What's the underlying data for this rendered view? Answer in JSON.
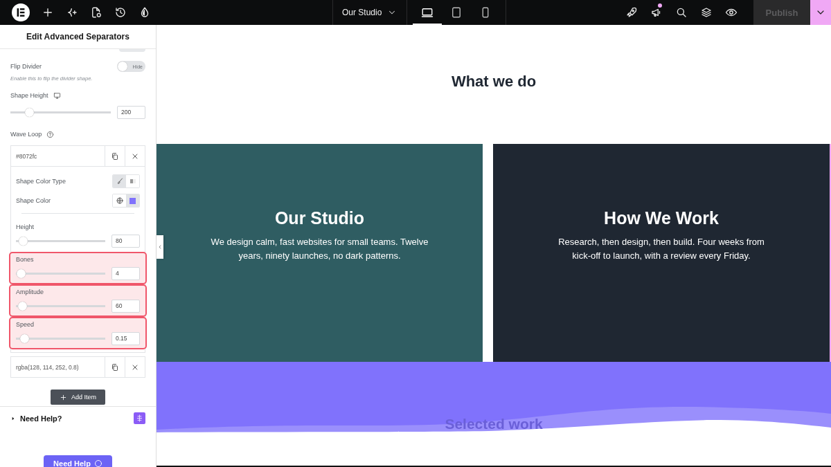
{
  "top_bar": {
    "page_selector": "Our Studio",
    "devices": [
      {
        "kind": "desktop",
        "selected": true
      },
      {
        "kind": "tablet",
        "selected": false
      },
      {
        "kind": "mobile",
        "selected": false
      }
    ],
    "notification": true,
    "publish": {
      "label": "Publish",
      "disabled": true
    }
  },
  "panel": {
    "title": "Edit Advanced Separators",
    "cut_toggle": {
      "on": false
    },
    "flip_divider": {
      "label": "Flip Divider",
      "toggle_label": "Hide",
      "on": false
    },
    "hint": "Enable this to flip the divider shape.",
    "shape_height": {
      "label": "Shape Height",
      "level": 0.19,
      "value": "200"
    },
    "wave_loop": {
      "label": "Wave Loop",
      "items": [
        {
          "value": "#8072fc",
          "expanded": true,
          "color_type_label": "Shape Color Type",
          "color_types": [
            {
              "kind": "solid",
              "selected": true
            },
            {
              "kind": "gradient",
              "selected": false
            }
          ],
          "color_label": "Shape Color",
          "color_sources": [
            {
              "kind": "global",
              "selected": false
            },
            {
              "kind": "custom",
              "selected": true,
              "color": "#8072fc"
            }
          ],
          "sliders": [
            {
              "label": "Height",
              "level": 0.08,
              "value": "80",
              "highlighted": false
            },
            {
              "label": "Bones",
              "level": 0.06,
              "value": "4",
              "highlighted": true
            },
            {
              "label": "Amplitude",
              "level": 0.07,
              "value": "60",
              "highlighted": true
            },
            {
              "label": "Speed",
              "level": 0.1,
              "value": "0.15",
              "highlighted": true
            }
          ]
        },
        {
          "value": "rgba(128, 114, 252, 0.8)",
          "expanded": false
        }
      ]
    },
    "add_item": "Add Item",
    "help": "Need Help?",
    "help_button": "Need Help"
  },
  "canvas": {
    "heading": "What we do",
    "cards": [
      {
        "title": "Our Studio",
        "text": "We design calm, fast websites for small teams. Twelve years, ninety launches, no dark patterns.",
        "color": "#2f5d62"
      },
      {
        "title": "How We Work",
        "text": "Research, then design, then build. Four weeks from kick-off to launch, with a review every Friday.",
        "color": "#1f2732"
      }
    ],
    "band_heading": "Selected work"
  }
}
